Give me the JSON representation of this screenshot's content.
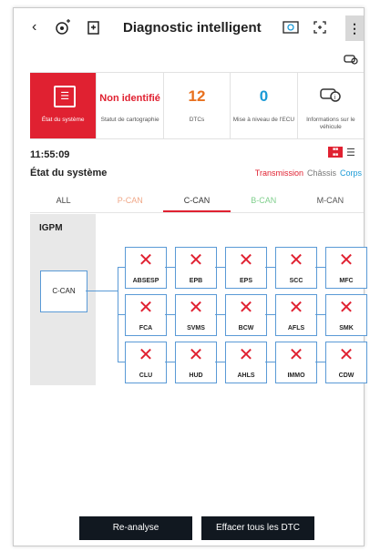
{
  "header": {
    "back_icon": "chevron-left-icon",
    "title": "Diagnostic intelligent"
  },
  "tiles": [
    {
      "value": "",
      "label": "État du système",
      "icon": "checklist-icon"
    },
    {
      "value": "Non identifié",
      "label": "Statut de cartographie"
    },
    {
      "value": "12",
      "label": "DTCs"
    },
    {
      "value": "0",
      "label": "Mise à niveau de l'ECU"
    },
    {
      "value": "",
      "label": "Informations sur le véhicule",
      "icon": "car-info-icon"
    }
  ],
  "time": "11:55:09",
  "section_title": "État du système",
  "filters": {
    "transmission": "Transmission",
    "chassis": "Châssis",
    "corps": "Corps"
  },
  "tabs": [
    "ALL",
    "P-CAN",
    "C-CAN",
    "B-CAN",
    "M-CAN"
  ],
  "diagram": {
    "module": "IGPM",
    "bus": "C-CAN",
    "ecus": [
      [
        "ABSESP",
        "EPB",
        "EPS",
        "SCC",
        "MFC"
      ],
      [
        "FCA",
        "SVMS",
        "BCW",
        "AFLS",
        "SMK"
      ],
      [
        "CLU",
        "HUD",
        "AHLS",
        "IMMO",
        "CDW"
      ]
    ]
  },
  "buttons": {
    "reanalyse": "Re-analyse",
    "clear": "Effacer tous les DTC"
  },
  "colors": {
    "accent": "#e02131",
    "line": "#5a9ad6",
    "button": "#111820"
  }
}
